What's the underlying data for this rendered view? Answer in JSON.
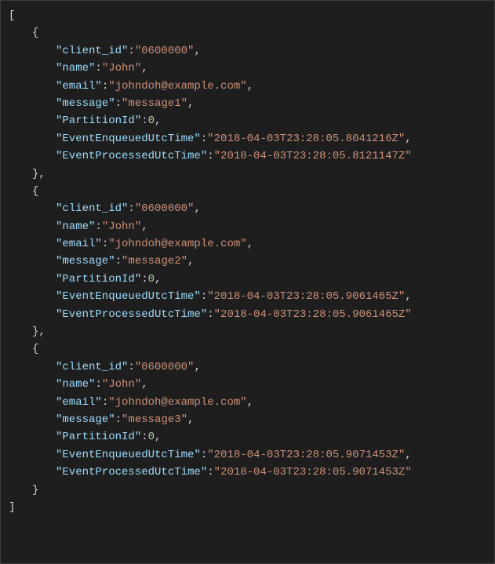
{
  "brackets": {
    "arrOpen": "[",
    "arrClose": "]",
    "objOpen": "{",
    "objClose": "}",
    "objCloseComma": "},"
  },
  "records": [
    {
      "fields": [
        {
          "k": "\"client_id\"",
          "colon": ":",
          "v": "\"0600000\"",
          "vt": "str",
          "comma": ","
        },
        {
          "k": "\"name\"",
          "colon": ":",
          "v": "\"John\"",
          "vt": "str",
          "comma": ","
        },
        {
          "k": "\"email\"",
          "colon": ":",
          "v": "\"johndoh@example.com\"",
          "vt": "str",
          "comma": ","
        },
        {
          "k": "\"message\"",
          "colon": ":",
          "v": "\"message1\"",
          "vt": "str",
          "comma": ","
        },
        {
          "k": "\"PartitionId\"",
          "colon": ":",
          "v": "0",
          "vt": "num",
          "comma": ","
        },
        {
          "k": "\"EventEnqueuedUtcTime\"",
          "colon": ":",
          "v": "\"2018-04-03T23:28:05.8041216Z\"",
          "vt": "str",
          "comma": ","
        },
        {
          "k": "\"EventProcessedUtcTime\"",
          "colon": ":",
          "v": "\"2018-04-03T23:28:05.8121147Z\"",
          "vt": "str",
          "comma": ""
        }
      ],
      "closer": "},"
    },
    {
      "fields": [
        {
          "k": "\"client_id\"",
          "colon": ":",
          "v": "\"0600000\"",
          "vt": "str",
          "comma": ","
        },
        {
          "k": "\"name\"",
          "colon": ":",
          "v": "\"John\"",
          "vt": "str",
          "comma": ","
        },
        {
          "k": "\"email\"",
          "colon": ":",
          "v": "\"johndoh@example.com\"",
          "vt": "str",
          "comma": ","
        },
        {
          "k": "\"message\"",
          "colon": ":",
          "v": "\"message2\"",
          "vt": "str",
          "comma": ","
        },
        {
          "k": "\"PartitionId\"",
          "colon": ":",
          "v": "0",
          "vt": "num",
          "comma": ","
        },
        {
          "k": "\"EventEnqueuedUtcTime\"",
          "colon": ":",
          "v": "\"2018-04-03T23:28:05.9061465Z\"",
          "vt": "str",
          "comma": ","
        },
        {
          "k": "\"EventProcessedUtcTime\"",
          "colon": ":",
          "v": "\"2018-04-03T23:28:05.9061465Z\"",
          "vt": "str",
          "comma": ""
        }
      ],
      "closer": "},"
    },
    {
      "fields": [
        {
          "k": "\"client_id\"",
          "colon": ":",
          "v": "\"0600000\"",
          "vt": "str",
          "comma": ","
        },
        {
          "k": "\"name\"",
          "colon": ":",
          "v": "\"John\"",
          "vt": "str",
          "comma": ","
        },
        {
          "k": "\"email\"",
          "colon": ":",
          "v": "\"johndoh@example.com\"",
          "vt": "str",
          "comma": ","
        },
        {
          "k": "\"message\"",
          "colon": ":",
          "v": "\"message3\"",
          "vt": "str",
          "comma": ","
        },
        {
          "k": "\"PartitionId\"",
          "colon": ":",
          "v": "0",
          "vt": "num",
          "comma": ","
        },
        {
          "k": "\"EventEnqueuedUtcTime\"",
          "colon": ":",
          "v": "\"2018-04-03T23:28:05.9071453Z\"",
          "vt": "str",
          "comma": ","
        },
        {
          "k": "\"EventProcessedUtcTime\"",
          "colon": ":",
          "v": "\"2018-04-03T23:28:05.9071453Z\"",
          "vt": "str",
          "comma": ""
        }
      ],
      "closer": "}"
    }
  ]
}
